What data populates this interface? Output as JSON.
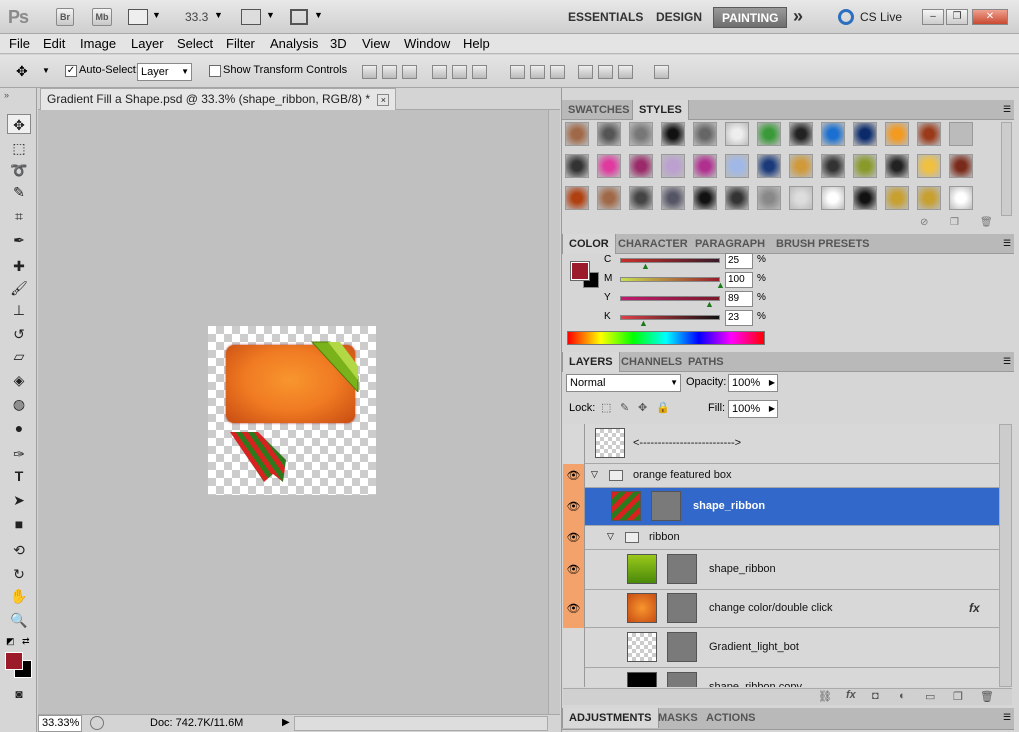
{
  "appbar": {
    "logo": "Ps",
    "bridge": "Br",
    "minibridge": "Mb",
    "zoom": "33.3",
    "workspaces": [
      "ESSENTIALS",
      "DESIGN",
      "PAINTING"
    ],
    "more": "»",
    "cslive": "CS Live"
  },
  "menu": [
    "File",
    "Edit",
    "Image",
    "Layer",
    "Select",
    "Filter",
    "Analysis",
    "3D",
    "View",
    "Window",
    "Help"
  ],
  "options": {
    "auto_select_label": "Auto-Select:",
    "auto_select_value": "Layer",
    "show_transform": "Show Transform Controls",
    "auto_select_checked": true
  },
  "document": {
    "tab_title": "Gradient Fill a Shape.psd @ 33.3% (shape_ribbon, RGB/8) *",
    "close": "×"
  },
  "status": {
    "zoom": "33.33%",
    "doc": "Doc: 742.7K/11.6M"
  },
  "swatches_tabs": [
    "SWATCHES",
    "STYLES"
  ],
  "color_tabs": [
    "COLOR",
    "CHARACTER",
    "PARAGRAPH",
    "BRUSH PRESETS"
  ],
  "color": {
    "fg": "#9b1b2a",
    "bg": "#000000",
    "channels": [
      {
        "label": "C",
        "value": "25",
        "pct": 25
      },
      {
        "label": "M",
        "value": "100",
        "pct": 100
      },
      {
        "label": "Y",
        "value": "89",
        "pct": 89
      },
      {
        "label": "K",
        "value": "23",
        "pct": 23
      }
    ],
    "unit": "%"
  },
  "layers_tabs": [
    "LAYERS",
    "CHANNELS",
    "PATHS"
  ],
  "layers_opts": {
    "blend": "Normal",
    "opacity_label": "Opacity:",
    "opacity": "100%",
    "lock_label": "Lock:",
    "fill_label": "Fill:",
    "fill": "100%"
  },
  "layers": [
    {
      "name": "<-------------------------->",
      "visible": false,
      "type": "layer"
    },
    {
      "name": "orange featured box",
      "visible": true,
      "type": "group"
    },
    {
      "name": "shape_ribbon",
      "visible": true,
      "type": "layer",
      "selected": true
    },
    {
      "name": "ribbon",
      "visible": true,
      "type": "group"
    },
    {
      "name": "shape_ribbon",
      "visible": true,
      "type": "layer"
    },
    {
      "name": "change color/double click",
      "visible": true,
      "type": "layer",
      "fx": "fx"
    },
    {
      "name": "Gradient_light_bot",
      "visible": false,
      "type": "layer"
    },
    {
      "name": "shape_ribbon copy",
      "visible": false,
      "type": "layer"
    }
  ],
  "bottom_tabs": [
    "ADJUSTMENTS",
    "MASKS",
    "ACTIONS"
  ],
  "colors": {
    "selected_row": "#3168c9",
    "eye_column": "#f2a26a",
    "accent_fg": "#9b1b2a"
  }
}
